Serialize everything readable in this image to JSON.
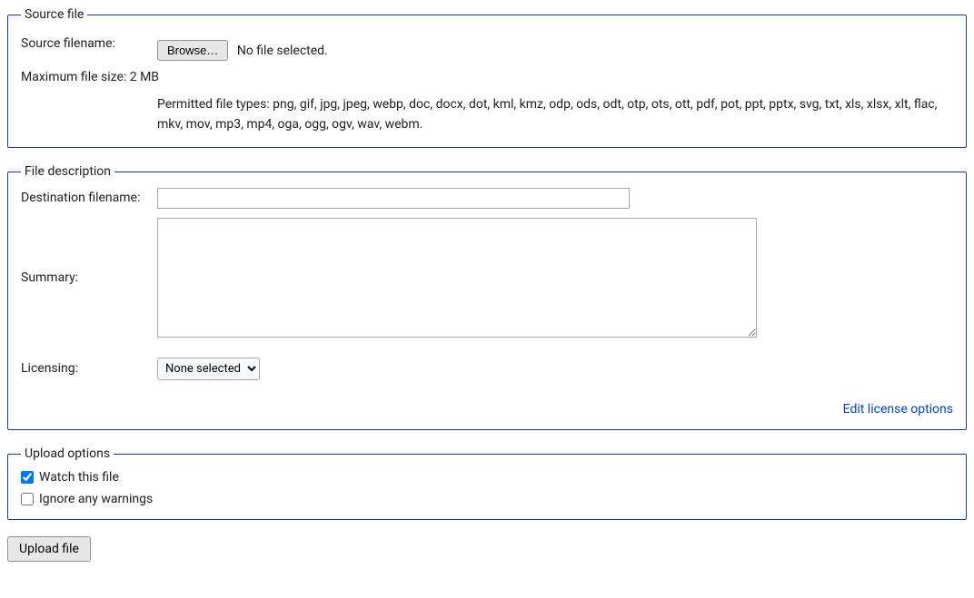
{
  "source_file": {
    "legend": "Source file",
    "filename_label": "Source filename:",
    "browse_button": "Browse…",
    "no_file_text": "No file selected.",
    "max_size_text": "Maximum file size: 2 MB",
    "permitted_text": "Permitted file types: png, gif, jpg, jpeg, webp, doc, docx, dot, kml, kmz, odp, ods, odt, otp, ots, ott, pdf, pot, ppt, pptx, svg, txt, xls, xlsx, xlt, flac, mkv, mov, mp3, mp4, oga, ogg, ogv, wav, webm."
  },
  "file_description": {
    "legend": "File description",
    "destination_label": "Destination filename:",
    "destination_value": "",
    "summary_label": "Summary:",
    "summary_value": "",
    "licensing_label": "Licensing:",
    "licensing_selected": "None selected",
    "edit_license_link": "Edit license options"
  },
  "upload_options": {
    "legend": "Upload options",
    "watch_label": "Watch this file",
    "watch_checked": true,
    "ignore_label": "Ignore any warnings",
    "ignore_checked": false
  },
  "upload_button": "Upload file"
}
